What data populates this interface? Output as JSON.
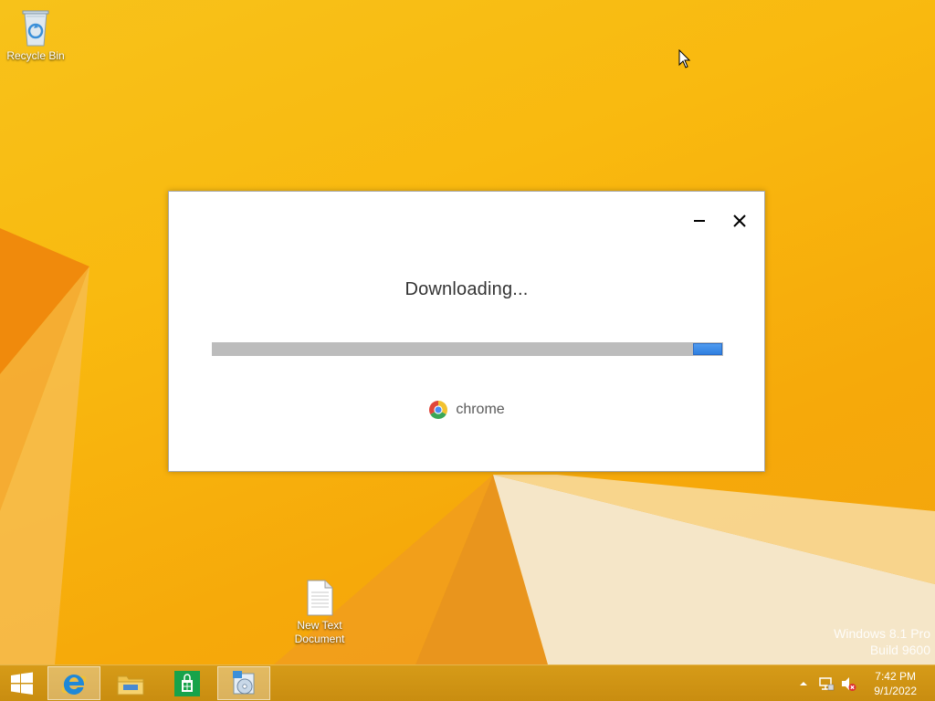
{
  "desktop": {
    "icons": [
      {
        "label": "Recycle Bin",
        "icon": "recycle-bin-icon"
      },
      {
        "label_line1": "New Text",
        "label_line2": "Document",
        "icon": "text-document-icon"
      }
    ],
    "watermark": {
      "line1": "Windows 8.1 Pro",
      "line2": "Build 9600"
    },
    "background_colors": {
      "primary": "#f9b90f",
      "accent_orange": "#f08a0c",
      "accent_cream": "#f5e6c8"
    }
  },
  "installer": {
    "status": "Downloading...",
    "brand": "chrome",
    "progress_state": "indeterminate",
    "minimize_icon": "minimize-icon",
    "close_icon": "close-icon",
    "accent_color": "#3b8ae6"
  },
  "taskbar": {
    "items": [
      {
        "name": "start",
        "icon": "windows-logo-icon"
      },
      {
        "name": "internet-explorer",
        "icon": "internet-explorer-icon"
      },
      {
        "name": "file-explorer",
        "icon": "folder-icon"
      },
      {
        "name": "store",
        "icon": "store-icon"
      },
      {
        "name": "installer",
        "icon": "installer-icon"
      }
    ],
    "tray": {
      "icons": [
        "show-hidden-icons-icon",
        "network-icon",
        "volume-muted-icon"
      ]
    },
    "clock": {
      "time": "7:42 PM",
      "date": "9/1/2022"
    }
  }
}
